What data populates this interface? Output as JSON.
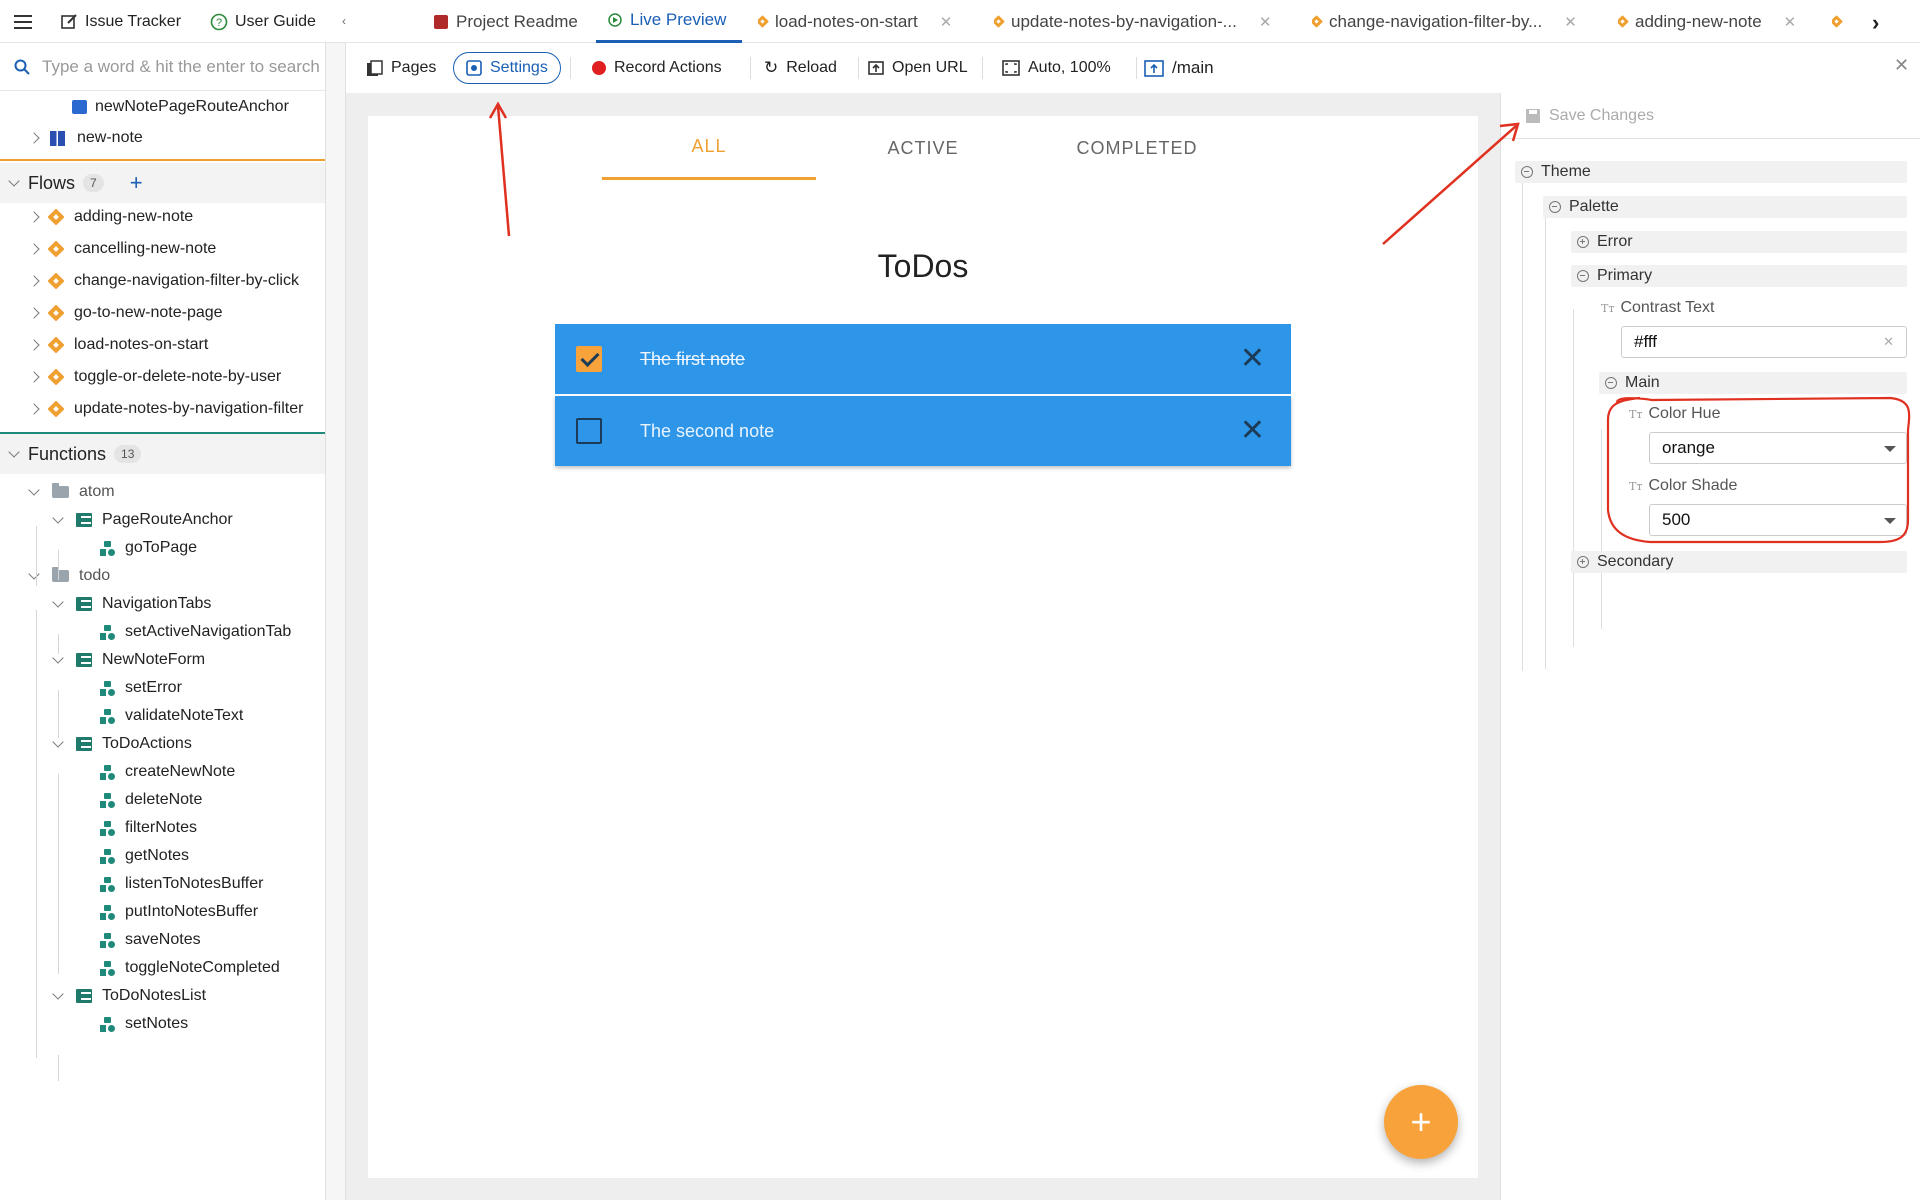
{
  "topbar": {
    "issue_tracker": "Issue Tracker",
    "user_guide": "User Guide",
    "tabs": [
      {
        "label": "Project Readme"
      },
      {
        "label": "Live Preview"
      },
      {
        "label": "load-notes-on-start"
      },
      {
        "label": "update-notes-by-navigation-..."
      },
      {
        "label": "change-navigation-filter-by..."
      },
      {
        "label": "adding-new-note"
      }
    ]
  },
  "sidebar": {
    "search_placeholder": "Type a word & hit the enter to search",
    "pages": [
      {
        "label": "newNotePageRouteAnchor"
      },
      {
        "label": "new-note"
      }
    ],
    "flows_title": "Flows",
    "flows_count": "7",
    "flows": [
      {
        "label": "adding-new-note"
      },
      {
        "label": "cancelling-new-note"
      },
      {
        "label": "change-navigation-filter-by-click"
      },
      {
        "label": "go-to-new-note-page"
      },
      {
        "label": "load-notes-on-start"
      },
      {
        "label": "toggle-or-delete-note-by-user"
      },
      {
        "label": "update-notes-by-navigation-filter"
      }
    ],
    "functions_title": "Functions",
    "functions_count": "13",
    "functions": [
      {
        "label": "atom"
      },
      {
        "label": "PageRouteAnchor"
      },
      {
        "label": "goToPage"
      },
      {
        "label": "todo"
      },
      {
        "label": "NavigationTabs"
      },
      {
        "label": "setActiveNavigationTab"
      },
      {
        "label": "NewNoteForm"
      },
      {
        "label": "setError"
      },
      {
        "label": "validateNoteText"
      },
      {
        "label": "ToDoActions"
      },
      {
        "label": "createNewNote"
      },
      {
        "label": "deleteNote"
      },
      {
        "label": "filterNotes"
      },
      {
        "label": "getNotes"
      },
      {
        "label": "listenToNotesBuffer"
      },
      {
        "label": "putIntoNotesBuffer"
      },
      {
        "label": "saveNotes"
      },
      {
        "label": "toggleNoteCompleted"
      },
      {
        "label": "ToDoNotesList"
      },
      {
        "label": "setNotes"
      }
    ]
  },
  "toolbar": {
    "pages": "Pages",
    "settings": "Settings",
    "record": "Record Actions",
    "reload": "Reload",
    "open_url": "Open URL",
    "zoom": "Auto, 100%",
    "route": "/main"
  },
  "preview": {
    "tabs": [
      "ALL",
      "ACTIVE",
      "COMPLETED"
    ],
    "title": "ToDos",
    "notes": [
      {
        "text": "The first note",
        "completed": true
      },
      {
        "text": "The second note",
        "completed": false
      }
    ],
    "fab": "+"
  },
  "settings": {
    "save": "Save Changes",
    "theme": "Theme",
    "palette": "Palette",
    "error": "Error",
    "primary": "Primary",
    "contrast_text_label": "Contrast Text",
    "contrast_text_value": "#fff",
    "main": "Main",
    "color_hue_label": "Color Hue",
    "color_hue_value": "orange",
    "color_shade_label": "Color Shade",
    "color_shade_value": "500",
    "secondary": "Secondary"
  },
  "colors": {
    "accent_blue": "#1a5fb4",
    "note_blue": "#2e96e8",
    "orange": "#f7a23a",
    "annotation_red": "#e03020"
  }
}
